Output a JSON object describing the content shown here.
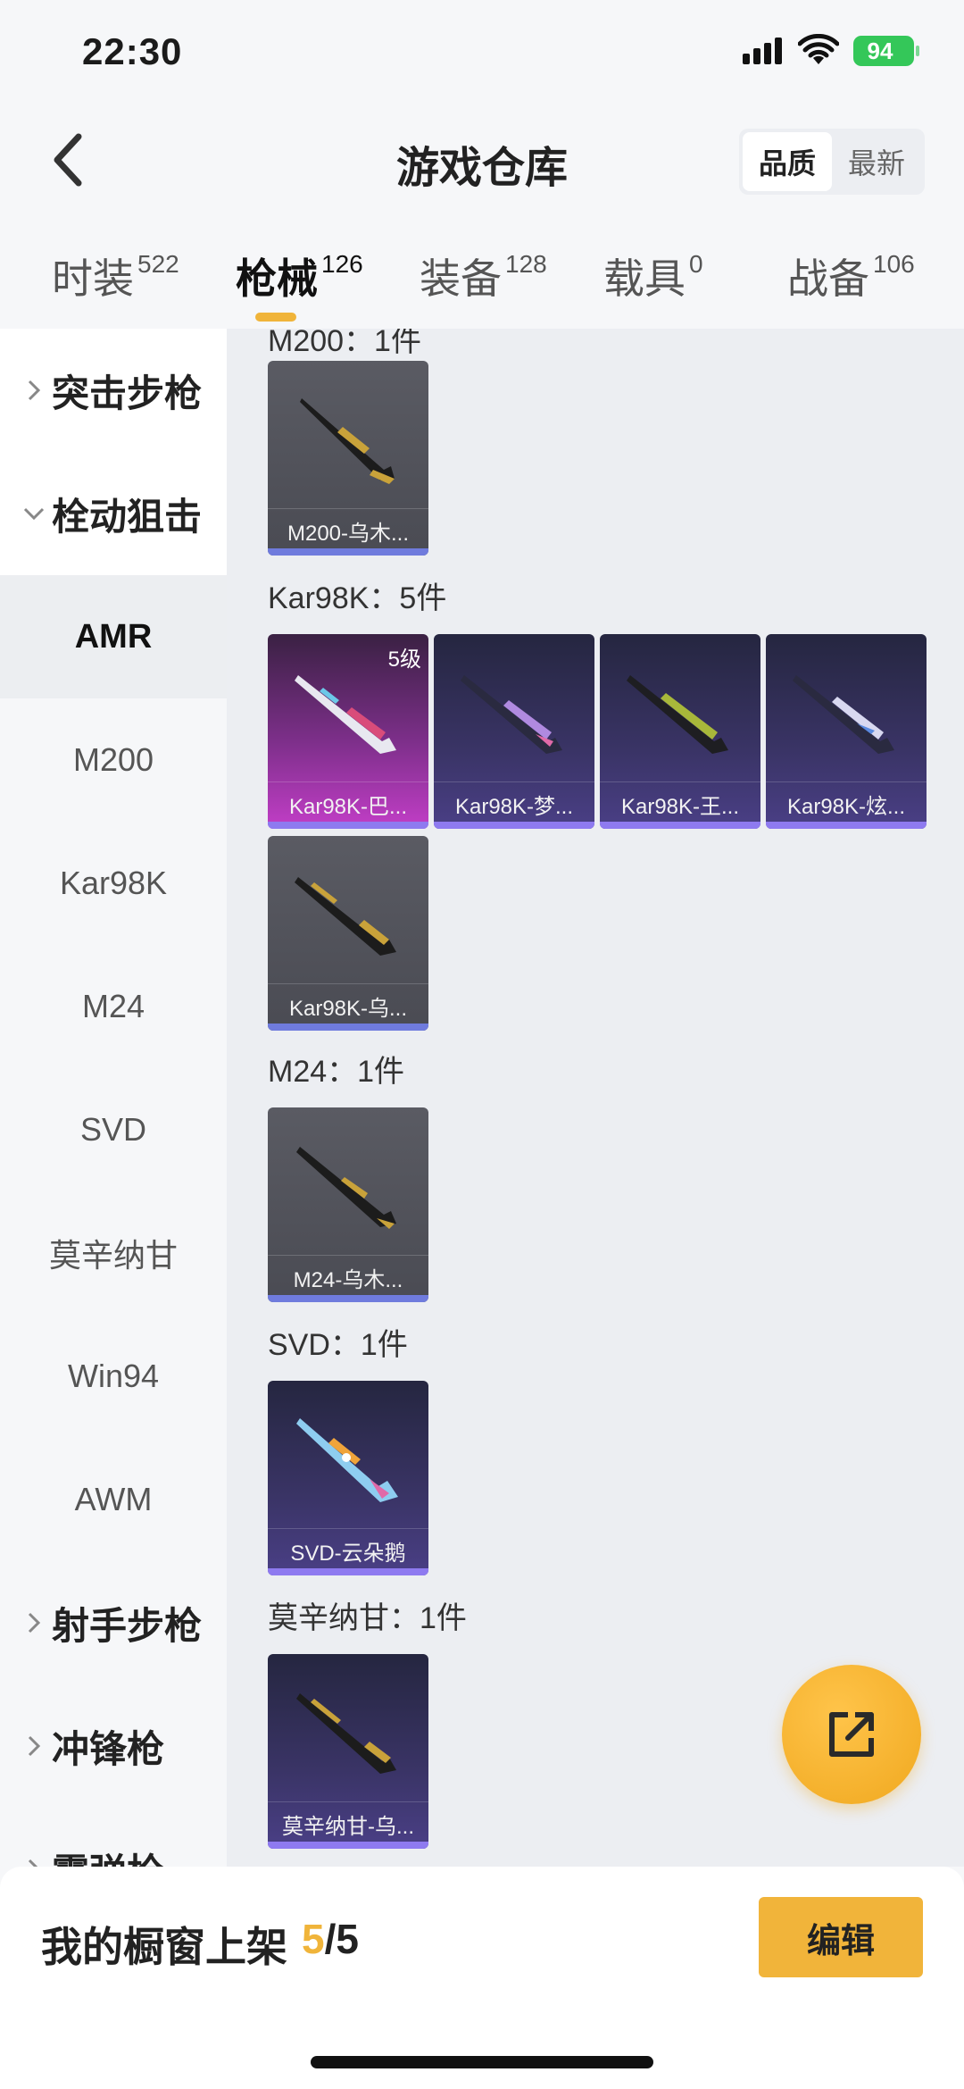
{
  "status_bar": {
    "time": "22:30",
    "battery": "94"
  },
  "header": {
    "title": "游戏仓库",
    "sort_options": [
      "品质",
      "最新"
    ],
    "active_sort": "品质"
  },
  "tabs": [
    {
      "label": "时装",
      "count": "522"
    },
    {
      "label": "枪械",
      "count": "126",
      "active": true
    },
    {
      "label": "装备",
      "count": "128"
    },
    {
      "label": "载具",
      "count": "0"
    },
    {
      "label": "战备",
      "count": "106"
    }
  ],
  "sidebar": {
    "groups": [
      {
        "label": "突击步枪"
      },
      {
        "label": "栓动狙击"
      },
      {
        "label": "射手步枪"
      },
      {
        "label": "冲锋枪"
      },
      {
        "label": "霰弹枪"
      }
    ],
    "subitems": [
      "AMR",
      "M200",
      "Kar98K",
      "M24",
      "SVD",
      "莫辛纳甘",
      "Win94",
      "AWM"
    ],
    "selected_subitem": "AMR"
  },
  "content": {
    "partial_title": "M200：1件",
    "groups": [
      {
        "title": "Kar98K：5件"
      },
      {
        "title": "M24：1件"
      },
      {
        "title": "SVD：1件"
      },
      {
        "title": "莫辛纳甘：1件"
      }
    ],
    "cards": {
      "m200_1": {
        "name": "M200-乌木...",
        "rarity": "grey"
      },
      "kar_1": {
        "name": "Kar98K-巴...",
        "rarity": "pink",
        "level": "5级"
      },
      "kar_2": {
        "name": "Kar98K-梦...",
        "rarity": "purple"
      },
      "kar_3": {
        "name": "Kar98K-王...",
        "rarity": "purple"
      },
      "kar_4": {
        "name": "Kar98K-炫...",
        "rarity": "purple"
      },
      "kar_5": {
        "name": "Kar98K-乌...",
        "rarity": "grey"
      },
      "m24_1": {
        "name": "M24-乌木...",
        "rarity": "grey"
      },
      "svd_1": {
        "name": "SVD-云朵鹅",
        "rarity": "purple"
      },
      "mosin_1": {
        "name": "莫辛纳甘-乌...",
        "rarity": "purple"
      }
    }
  },
  "bottom": {
    "label": "我的橱窗上架",
    "current": "5",
    "separator": "/",
    "total": "5",
    "edit_label": "编辑"
  },
  "colors": {
    "accent": "#f0b43a",
    "rarity_grey": "#4a4b53",
    "rarity_purple": "#3a3466",
    "rarity_pink": "#c23ec7"
  },
  "icons": [
    "signal-icon",
    "wifi-icon",
    "back-arrow-icon",
    "chevron-right-icon",
    "chevron-down-icon",
    "share-icon",
    "gun-icon"
  ]
}
